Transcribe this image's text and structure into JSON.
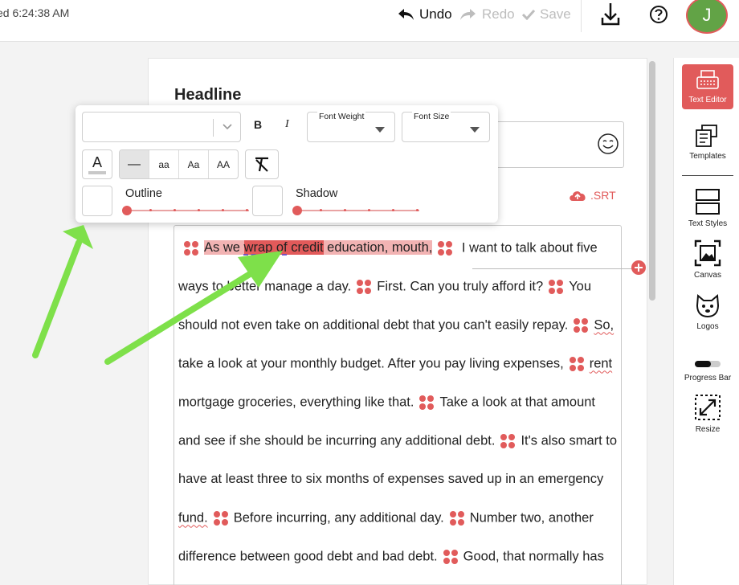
{
  "header": {
    "saved_status": "ed 6:24:38 AM",
    "undo_label": "Undo",
    "redo_label": "Redo",
    "save_label": "Save",
    "download_icon": "download-icon",
    "help_icon": "help-circle-icon",
    "avatar_initial": "J"
  },
  "editor": {
    "headline_label": "Headline",
    "headline_value": "",
    "srt_label": ".SRT",
    "text_lines": [
      [
        "",
        "As we ",
        "wrap of",
        " credit",
        " education, mouth,",
        "",
        " I want to talk about five"
      ],
      [
        "ways to better manage a day.",
        "First. Can you truly afford it?",
        "You"
      ],
      [
        "should not even take on additional debt that you can't easily repay.",
        "So,"
      ],
      [
        "take a look at your monthly budget. After you pay living expenses,",
        "rent"
      ],
      [
        "mortgage groceries, everything like that.",
        "Take a look at that amount"
      ],
      [
        "and see if she should be incurring any additional debt.",
        "It's also smart to"
      ],
      [
        "have at least three to six months of expenses saved up in an emergency"
      ],
      [
        "fund.",
        "Before incurring, any additional day.",
        "Number two, another"
      ],
      [
        "difference between good debt and bad debt.",
        "Good, that normally has"
      ]
    ]
  },
  "toolbar": {
    "font_family_value": "",
    "bold_label": "B",
    "italic_label": "I",
    "font_weight_label": "Font Weight",
    "font_size_label": "Font Size",
    "color_glyph": "A",
    "case_options": [
      "—",
      "aa",
      "Aa",
      "AA"
    ],
    "outline_label": "Outline",
    "shadow_label": "Shadow"
  },
  "sidebar": {
    "items": [
      {
        "label": "Text Editor",
        "icon": "typewriter-icon"
      },
      {
        "label": "Templates",
        "icon": "templates-icon"
      },
      {
        "label": "Text Styles",
        "icon": "text-styles-icon"
      },
      {
        "label": "Canvas",
        "icon": "canvas-icon"
      },
      {
        "label": "Logos",
        "icon": "logo-dog-icon"
      },
      {
        "label": "Progress Bar",
        "icon": "progress-bar-icon"
      },
      {
        "label": "Resize",
        "icon": "resize-icon"
      }
    ]
  },
  "colors": {
    "accent": "#e15b5b",
    "highlight_light": "#f2b3b3",
    "highlight_strong": "#e25a5a",
    "annotation_arrow": "#7ee04a",
    "avatar_bg": "#62a346"
  }
}
